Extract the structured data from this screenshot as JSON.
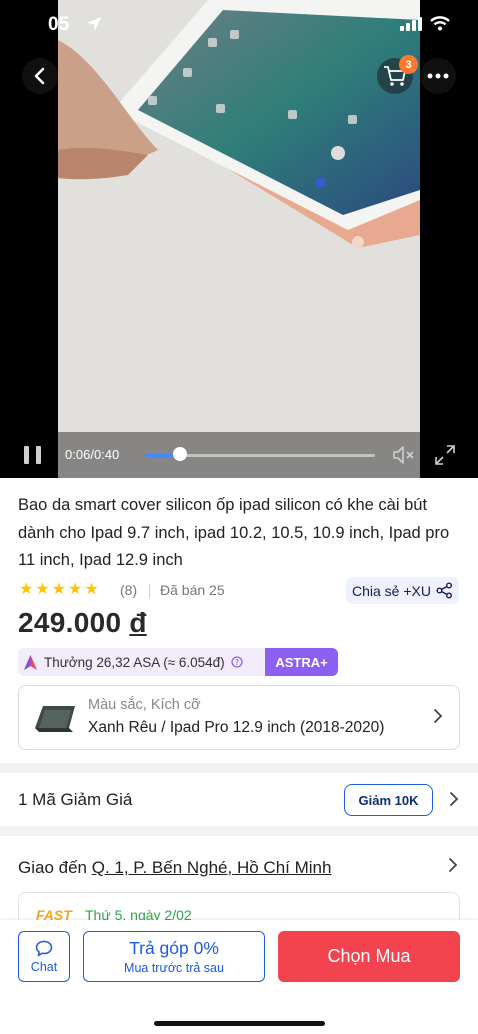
{
  "status_bar": {
    "time": "05"
  },
  "video": {
    "cart_count": "3",
    "elapsed": "0:06",
    "duration": "0:40",
    "progress": 0.15
  },
  "product": {
    "title": "Bao da smart cover silicon ốp ipad silicon có khe cài bút dành cho Ipad 9.7 inch, ipad 10.2, 10.5, 10.9 inch, Ipad pro 11 inch, Ipad 12.9 inch",
    "stars": 5,
    "rating_count": "(8)",
    "sold": "Đã bán 25",
    "share_label": "Chia sẻ +XU",
    "price": "249.000",
    "currency": "đ",
    "reward_text": "Thưởng 26,32 ASA (≈ 6.054đ)",
    "reward_badge": "ASTRA+"
  },
  "variant": {
    "label": "Màu sắc, Kích cỡ",
    "value": "Xanh Rêu / Ipad Pro 12.9 inch (2018-2020)"
  },
  "voucher": {
    "text": "1 Mã Giảm Giá",
    "chip": "Giảm 10K"
  },
  "shipping": {
    "prefix": "Giao đến",
    "address": "Q. 1, P. Bến Nghé, Hồ Chí Minh",
    "fast_label": "FAST",
    "fast_date": "Thứ 5, ngày 2/02"
  },
  "bottom_bar": {
    "chat_label": "Chat",
    "installment_title": "Trả góp 0%",
    "installment_sub": "Mua trước trả sau",
    "buy_label": "Chọn Mua"
  },
  "colors": {
    "accent_blue": "#1a5be0",
    "buy_red": "#f2434f",
    "star_yellow": "#ffc400",
    "astra_purple": "#8c5ff0"
  }
}
